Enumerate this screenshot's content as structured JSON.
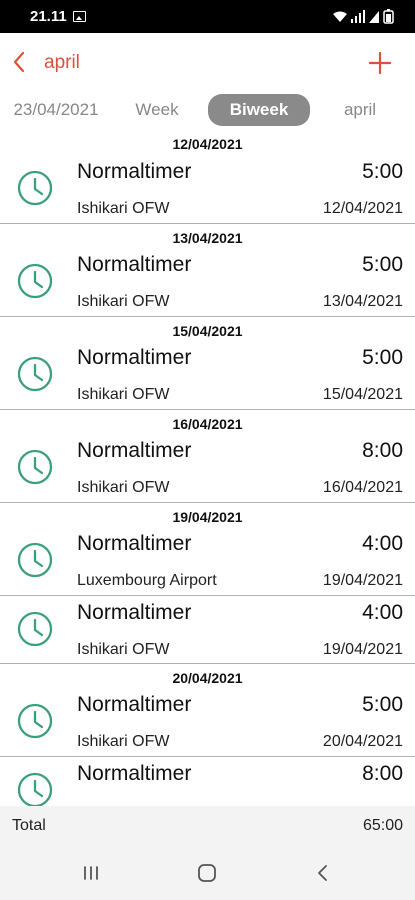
{
  "status_bar": {
    "time": "21.11"
  },
  "app_bar": {
    "title": "april"
  },
  "tabs": {
    "date": "23/04/2021",
    "week": "Week",
    "biweek": "Biweek",
    "month": "april"
  },
  "entries": [
    {
      "header": "12/04/2021",
      "title": "Normaltimer",
      "hours": "5:00",
      "location": "Ishikari OFW",
      "date": "12/04/2021"
    },
    {
      "header": "13/04/2021",
      "title": "Normaltimer",
      "hours": "5:00",
      "location": "Ishikari OFW",
      "date": "13/04/2021"
    },
    {
      "header": "15/04/2021",
      "title": "Normaltimer",
      "hours": "5:00",
      "location": "Ishikari OFW",
      "date": "15/04/2021"
    },
    {
      "header": "16/04/2021",
      "title": "Normaltimer",
      "hours": "8:00",
      "location": "Ishikari OFW",
      "date": "16/04/2021"
    },
    {
      "header": "19/04/2021",
      "title": "Normaltimer",
      "hours": "4:00",
      "location": "Luxembourg Airport",
      "date": "19/04/2021"
    },
    {
      "title": "Normaltimer",
      "hours": "4:00",
      "location": "Ishikari OFW",
      "date": "19/04/2021"
    },
    {
      "header": "20/04/2021",
      "title": "Normaltimer",
      "hours": "5:00",
      "location": "Ishikari OFW",
      "date": "20/04/2021"
    },
    {
      "title": "Normaltimer",
      "hours": "8:00",
      "location": "",
      "date": ""
    }
  ],
  "total": {
    "label": "Total",
    "value": "65:00"
  },
  "icons": {
    "clock": "clock-icon",
    "back": "chevron-left-icon",
    "add": "plus-icon"
  },
  "colors": {
    "accent": "#d9533c",
    "clock": "#3aa07a",
    "selected_tab": "#8a8a8a"
  }
}
